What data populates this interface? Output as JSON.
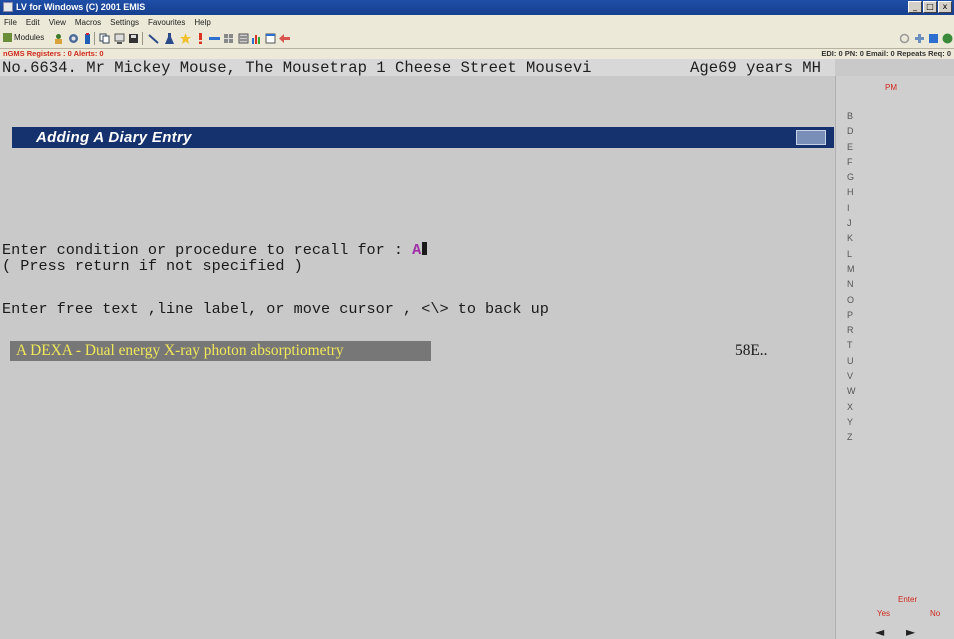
{
  "window": {
    "title": "LV for Windows (C) 2001 EMIS",
    "minimize": "_",
    "maximize": "□",
    "close": "x"
  },
  "menu": [
    "File",
    "Edit",
    "View",
    "Macros",
    "Settings",
    "Favourites",
    "Help"
  ],
  "toolbar": {
    "modules_label": "Modules",
    "icons": [
      "patient-icon",
      "group-icon",
      "bottle-icon",
      "copy-icon",
      "screen-icon",
      "save-icon",
      "pen-icon",
      "flask-icon",
      "star-icon",
      "alert-icon",
      "bar-icon",
      "grid-icon",
      "list-icon",
      "chart-icon",
      "window-icon",
      "back-arrow-icon"
    ],
    "right_icons": [
      "circle-icon",
      "plus-icon",
      "book-icon",
      "info-icon"
    ]
  },
  "status": {
    "left": "nGMS Registers : 0  Alerts: 0",
    "right": "EDI: 0  PN: 0  Email: 0  Repeats Req: 0"
  },
  "patient": {
    "line": "No.6634. Mr Mickey Mouse, The Mousetrap 1 Cheese Street Mousevi",
    "age": "Age69 years MH"
  },
  "screen": {
    "header": "Adding A Diary Entry",
    "prompt": "Enter condition or procedure to recall for : ",
    "prompt_value": "A",
    "hint": "( Press return if not specified )",
    "instruction": "Enter free text ,line label, or move cursor , <\\> to back up",
    "result_text": "A DEXA - Dual energy X-ray photon absorptiometry",
    "result_code": "58E.."
  },
  "panel": {
    "label": "PM",
    "letters": [
      "B",
      "D",
      "E",
      "F",
      "G",
      "H",
      "I",
      "J",
      "K",
      "L",
      "M",
      "N",
      "O",
      "P",
      "R",
      "T",
      "U",
      "V",
      "W",
      "X",
      "Y",
      "Z"
    ],
    "enter": "Enter",
    "yes": "Yes",
    "no": "No",
    "arrows": "◄ ► ▲ ▼"
  },
  "colors": {
    "header_bg": "#15316e",
    "result_bg": "#777777",
    "result_text": "#f2e85a",
    "status_red": "#d0281c",
    "prompt_value": "#a030a8"
  }
}
